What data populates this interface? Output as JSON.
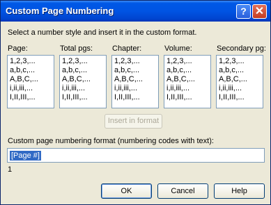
{
  "window": {
    "title": "Custom Page Numbering",
    "help_glyph": "?",
    "close_glyph": "✕"
  },
  "instruction": "Select a number style and insert it in the custom format.",
  "columns": [
    {
      "label": "Page:",
      "items": [
        "1,2,3,...",
        "a,b,c,...",
        "A,B,C,...",
        "i,ii,iii,...",
        "I,II,III,..."
      ]
    },
    {
      "label": "Total pgs:",
      "items": [
        "1,2,3,...",
        "a,b,c,...",
        "A,B,C,...",
        "i,ii,iii,...",
        "I,II,III,..."
      ]
    },
    {
      "label": "Chapter:",
      "items": [
        "1,2,3,...",
        "a,b,c,...",
        "A,B,C,...",
        "i,ii,iii,...",
        "I,II,III,..."
      ]
    },
    {
      "label": "Volume:",
      "items": [
        "1,2,3,...",
        "a,b,c,...",
        "A,B,C,...",
        "i,ii,iii,...",
        "I,II,III,..."
      ]
    },
    {
      "label": "Secondary pg:",
      "items": [
        "1,2,3,...",
        "a,b,c,...",
        "A,B,C,...",
        "i,ii,iii,...",
        "I,II,III,..."
      ]
    }
  ],
  "insert_button": "Insert in format",
  "format_label": "Custom page numbering format (numbering codes with text):",
  "format_value": "[Page #]",
  "preview": "1",
  "buttons": {
    "ok": "OK",
    "cancel": "Cancel",
    "help": "Help"
  }
}
